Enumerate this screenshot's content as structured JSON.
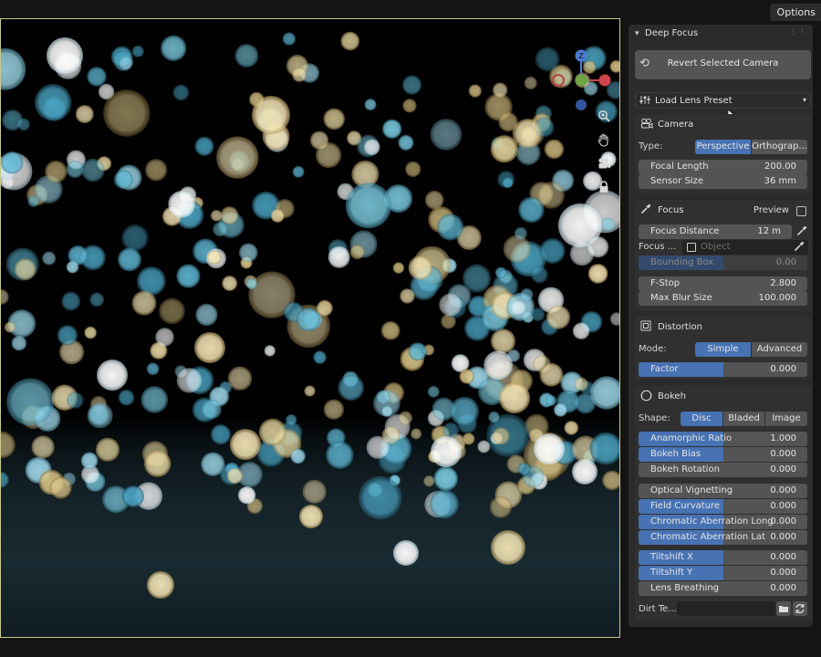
{
  "topbar": {
    "options_label": "Options"
  },
  "viewport": {
    "border_color": "#c8c98a",
    "gizmo": {
      "axis_z": "Z",
      "icons": [
        "zoom-in-icon",
        "hand-pan-icon",
        "camera-icon",
        "lock-icon"
      ]
    }
  },
  "sidebar": {
    "title": "Deep Focus",
    "revert_button": "Revert Selected Camera",
    "lens_preset": "Load Lens Preset",
    "camera": {
      "title": "Camera",
      "type_label": "Type:",
      "type_options": [
        "Perspective",
        "Orthograp..."
      ],
      "type_selected": "Perspective",
      "focal_length": {
        "label": "Focal Length",
        "value": "200.00"
      },
      "sensor_size": {
        "label": "Sensor Size",
        "value": "36 mm"
      }
    },
    "focus": {
      "title": "Focus",
      "preview_label": "Preview",
      "preview_checked": false,
      "focus_distance": {
        "label": "Focus Distance",
        "value": "12 m"
      },
      "focus_object_label": "Focus ...",
      "focus_object_placeholder": "Object",
      "bounding_box": {
        "label": "Bounding Box",
        "value": "0.00",
        "fill": 0.5
      },
      "f_stop": {
        "label": "F-Stop",
        "value": "2.800"
      },
      "max_blur": {
        "label": "Max Blur Size",
        "value": "100.000"
      }
    },
    "distortion": {
      "title": "Distortion",
      "mode_label": "Mode:",
      "mode_options": [
        "Simple",
        "Advanced"
      ],
      "mode_selected": "Simple",
      "factor": {
        "label": "Factor",
        "value": "0.000",
        "fill": 0.5
      }
    },
    "bokeh": {
      "title": "Bokeh",
      "shape_label": "Shape:",
      "shape_options": [
        "Disc",
        "Bladed",
        "Image"
      ],
      "shape_selected": "Disc",
      "group1": [
        {
          "label": "Anamorphic Ratio",
          "value": "1.000",
          "fill": 0.5
        },
        {
          "label": "Bokeh Bias",
          "value": "0.000",
          "fill": 0.5
        },
        {
          "label": "Bokeh Rotation",
          "value": "0.000",
          "fill": 0
        }
      ],
      "group2": [
        {
          "label": "Optical Vignetting",
          "value": "0.000",
          "fill": 0
        },
        {
          "label": "Field Curvature",
          "value": "0.000",
          "fill": 0.5
        },
        {
          "label": "Chromatic Aberration Long",
          "value": "0.000",
          "fill": 0.5
        },
        {
          "label": "Chromatic Aberration Lat",
          "value": "0.000",
          "fill": 0.5
        }
      ],
      "group3": [
        {
          "label": "Tiltshift X",
          "value": "0.000",
          "fill": 0.5
        },
        {
          "label": "Tiltshift Y",
          "value": "0.000",
          "fill": 0.5
        },
        {
          "label": "Lens Breathing",
          "value": "0.000",
          "fill": 0
        }
      ],
      "dirt_texture_label": "Dirt Te..."
    }
  },
  "colors": {
    "accent": "#4772b3",
    "panel": "#303030",
    "field": "#545454"
  }
}
